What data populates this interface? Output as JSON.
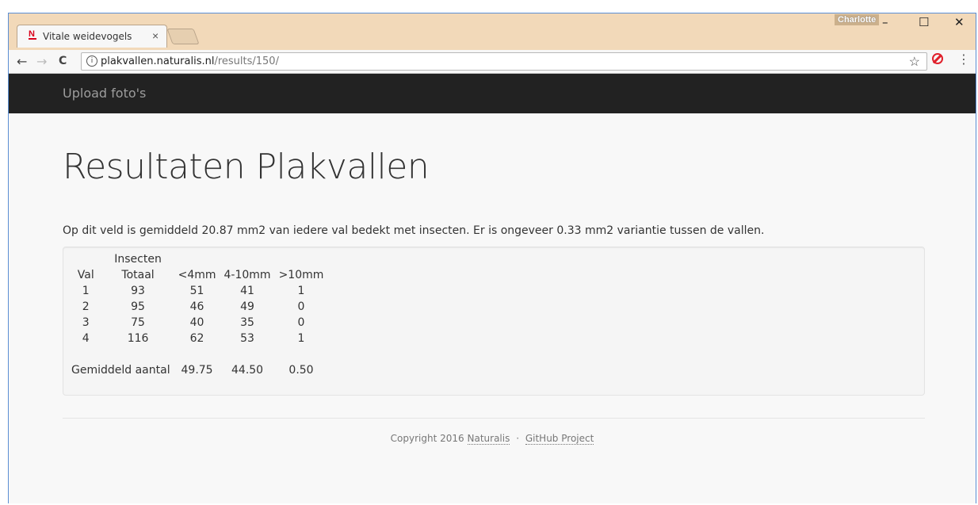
{
  "browser": {
    "tab_title": "Vitale weidevogels",
    "tab_close": "×",
    "profile_name": "Charlotte",
    "url_host": "plakvallen.naturalis.nl",
    "url_path": "/results/150/",
    "icons": {
      "back": "←",
      "forward": "→",
      "reload": "C",
      "info": "i",
      "star": "☆",
      "menu": "⋮",
      "minimize": "–",
      "maximize": "☐",
      "close": "✕"
    }
  },
  "navbar": {
    "upload_link": "Upload foto's",
    "background": "#222222"
  },
  "page": {
    "title": "Resultaten Plakvallen",
    "summary": "Op dit veld is gemiddeld 20.87 mm2 van iedere val bedekt met insecten. Er is ongeveer 0.33 mm2 variantie tussen de vallen."
  },
  "table": {
    "group_header": "Insecten",
    "headers": [
      "Val",
      "Totaal",
      "<4mm",
      "4-10mm",
      ">10mm"
    ],
    "rows": [
      [
        "1",
        "93",
        "51",
        "41",
        "1"
      ],
      [
        "2",
        "95",
        "46",
        "49",
        "0"
      ],
      [
        "3",
        "75",
        "40",
        "35",
        "0"
      ],
      [
        "4",
        "116",
        "62",
        "53",
        "1"
      ]
    ],
    "average_label": "Gemiddeld aantal",
    "averages": [
      "49.75",
      "44.50",
      "0.50"
    ]
  },
  "footer": {
    "copyright": "Copyright 2016",
    "naturalis_link": "Naturalis",
    "separator": "·",
    "github_link": "GitHub Project"
  }
}
